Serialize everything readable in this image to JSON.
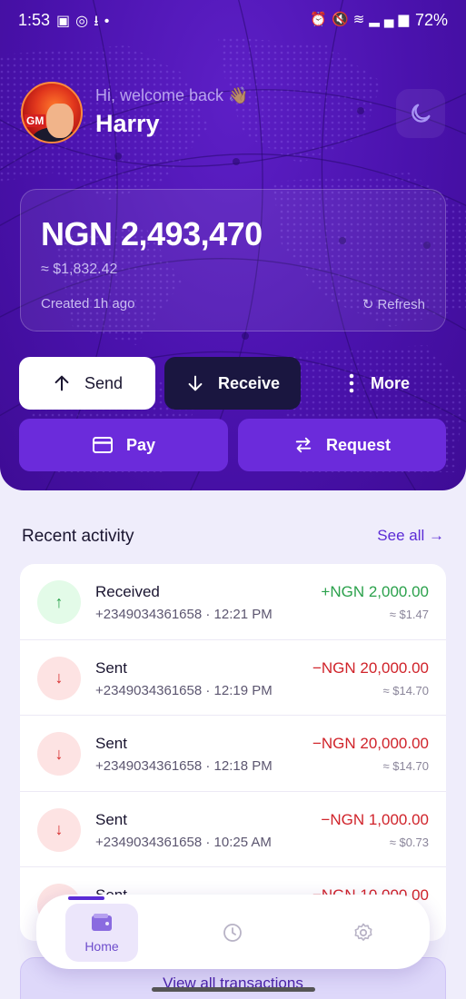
{
  "status_bar": {
    "time": "1:53",
    "battery": "72%",
    "left_icons": [
      "gallery-icon",
      "whatsapp-icon",
      "download-icon",
      "dot-icon"
    ],
    "right_icons": [
      "alarm-icon",
      "mute-icon",
      "wifi-icon",
      "signal-icon",
      "battery-icon"
    ]
  },
  "header": {
    "greeting": "Hi, welcome back 👋🏽",
    "username": "Harry",
    "avatar_badge": "GM",
    "theme_toggle_icon": "moon-icon"
  },
  "balance": {
    "amount": "NGN 2,493,470",
    "usd": "≈ $1,832.42",
    "created": "Created 1h ago",
    "refresh": "Refresh"
  },
  "actions": {
    "send": "Send",
    "receive": "Receive",
    "more": "More",
    "pay": "Pay",
    "request": "Request"
  },
  "activity": {
    "title": "Recent activity",
    "see_all": "See all →",
    "transactions": [
      {
        "type": "in",
        "title": "Received",
        "subtitle": "+2349034361658 · 12:21 PM",
        "amount": "+NGN 2,000.00",
        "usd": "≈ $1.47"
      },
      {
        "type": "out",
        "title": "Sent",
        "subtitle": "+2349034361658 · 12:19 PM",
        "amount": "−NGN 20,000.00",
        "usd": "≈ $14.70"
      },
      {
        "type": "out",
        "title": "Sent",
        "subtitle": "+2349034361658 · 12:18 PM",
        "amount": "−NGN 20,000.00",
        "usd": "≈ $14.70"
      },
      {
        "type": "out",
        "title": "Sent",
        "subtitle": "+2349034361658 · 10:25 AM",
        "amount": "−NGN 1,000.00",
        "usd": "≈ $0.73"
      },
      {
        "type": "out",
        "title": "Sent",
        "subtitle": "",
        "amount": "−NGN 10,000.00",
        "usd": ""
      }
    ],
    "view_all": "View all transactions"
  },
  "nav": {
    "home": "Home",
    "items": [
      "wallet-icon",
      "clock-icon",
      "gear-icon"
    ],
    "active": "Home"
  },
  "colors": {
    "primary": "#4a12ad",
    "accent": "#6b2bdb",
    "positive": "#2aa14b",
    "negative": "#d0232a"
  }
}
